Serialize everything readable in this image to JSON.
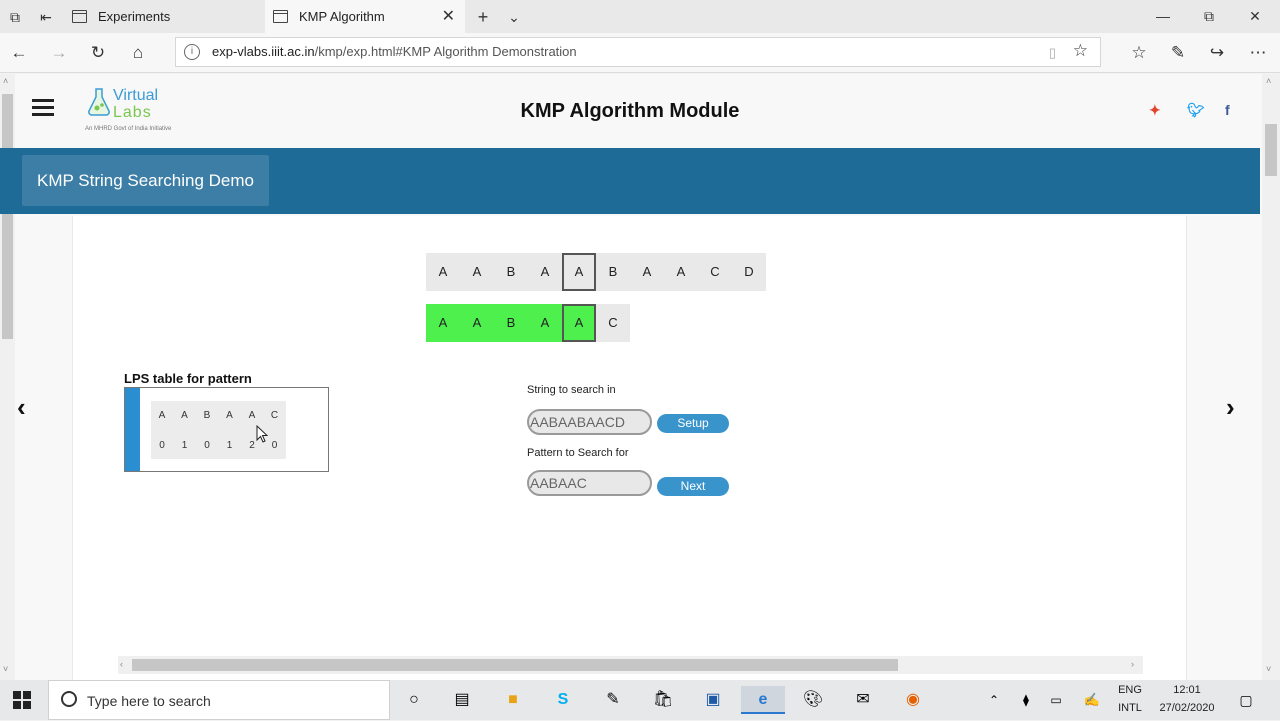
{
  "browser": {
    "tabs": [
      {
        "label": "Experiments",
        "active": false
      },
      {
        "label": "KMP Algorithm",
        "active": true
      }
    ],
    "url_domain": "exp-vlabs.iiit.ac.in",
    "url_path": "/kmp/exp.html#KMP Algorithm Demonstration"
  },
  "header": {
    "logo_line1": "Virtual",
    "logo_line2": "Labs",
    "logo_tagline": "An MHRD Govt of India Initiative",
    "title": "KMP Algorithm Module"
  },
  "banner": {
    "label": "KMP String Searching Demo"
  },
  "demo": {
    "text_chars": [
      "A",
      "A",
      "B",
      "A",
      "A",
      "B",
      "A",
      "A",
      "C",
      "D"
    ],
    "text_focus_index": 4,
    "pattern_chars": [
      "A",
      "A",
      "B",
      "A",
      "A",
      "C"
    ],
    "pattern_matched_count": 5,
    "pattern_focus_index": 4
  },
  "lps": {
    "title": "LPS table for pattern",
    "chars": [
      "A",
      "A",
      "B",
      "A",
      "A",
      "C"
    ],
    "values": [
      "0",
      "1",
      "0",
      "1",
      "2",
      "0"
    ]
  },
  "form": {
    "string_label": "String to search in",
    "string_value": "AABAABAACD",
    "setup_button": "Setup",
    "pattern_label": "Pattern to Search for",
    "pattern_value": "AABAAC",
    "next_button": "Next"
  },
  "taskbar": {
    "search_placeholder": "Type here to search",
    "lang_top": "ENG",
    "lang_bottom": "INTL",
    "time": "12:01",
    "date": "27/02/2020"
  },
  "colors": {
    "banner": "#1f6b98",
    "match": "#4ef04e",
    "button": "#3a94cc"
  }
}
